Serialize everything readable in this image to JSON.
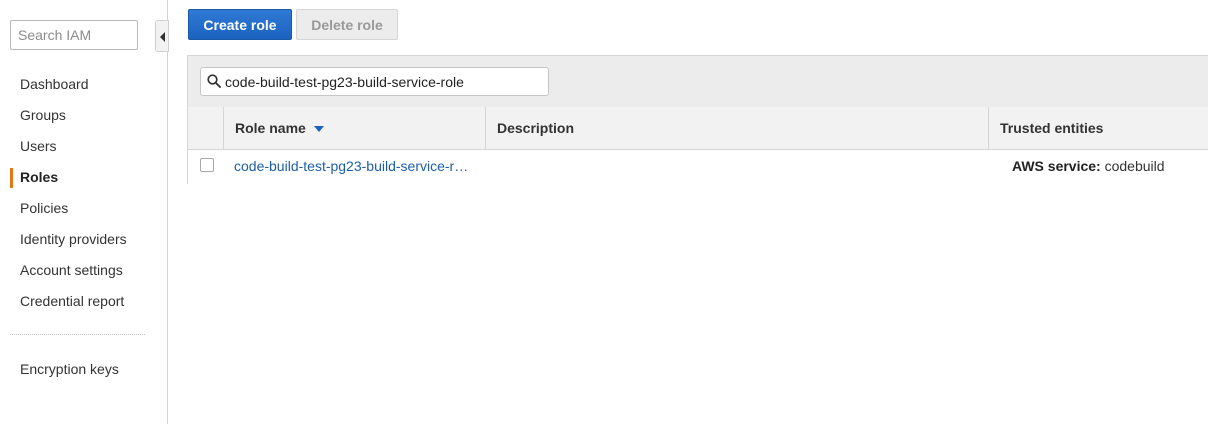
{
  "sidebar": {
    "search_placeholder": "Search IAM",
    "items": [
      {
        "label": "Dashboard"
      },
      {
        "label": "Groups"
      },
      {
        "label": "Users"
      },
      {
        "label": "Roles",
        "active": true
      },
      {
        "label": "Policies"
      },
      {
        "label": "Identity providers"
      },
      {
        "label": "Account settings"
      },
      {
        "label": "Credential report"
      }
    ],
    "extra_items": [
      {
        "label": "Encryption keys"
      }
    ]
  },
  "toolbar": {
    "create_label": "Create role",
    "delete_label": "Delete role"
  },
  "filter": {
    "value": "code-build-test-pg23-build-service-role",
    "icon": "search-icon"
  },
  "table": {
    "columns": {
      "name": "Role name",
      "description": "Description",
      "trusted": "Trusted entities"
    },
    "sort": "descending",
    "rows": [
      {
        "role_name": "code-build-test-pg23-build-service-r…",
        "description": "",
        "trusted_prefix": "AWS service:",
        "trusted_value": "codebuild"
      }
    ]
  },
  "colors": {
    "accent": "#e47911",
    "primary_button": "#1b62bf",
    "link": "#1d5fa7"
  }
}
